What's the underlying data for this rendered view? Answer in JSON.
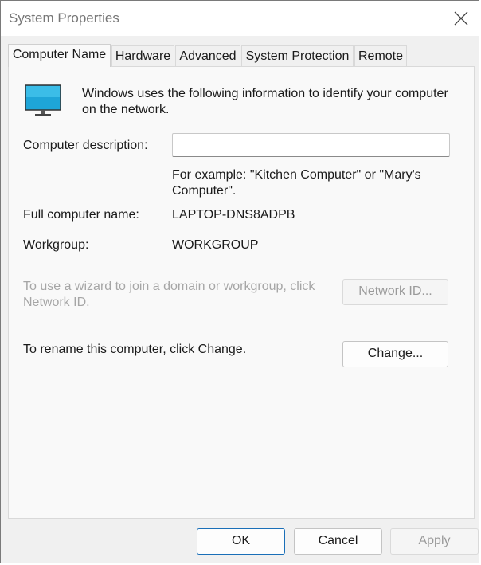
{
  "window": {
    "title": "System Properties"
  },
  "tabs": [
    {
      "label": "Computer Name",
      "active": true
    },
    {
      "label": "Hardware"
    },
    {
      "label": "Advanced"
    },
    {
      "label": "System Protection"
    },
    {
      "label": "Remote"
    }
  ],
  "computer_name": {
    "intro": "Windows uses the following information to identify your computer on the network.",
    "description_label": "Computer description:",
    "description_value": "",
    "example_text": "For example: \"Kitchen Computer\" or \"Mary's Computer\".",
    "full_name_label": "Full computer name:",
    "full_name_value": "LAPTOP-DNS8ADPB",
    "workgroup_label": "Workgroup:",
    "workgroup_value": "WORKGROUP",
    "network_id_text": "To use a wizard to join a domain or workgroup, click Network ID.",
    "network_id_button": "Network ID...",
    "rename_text": "To rename this computer, click Change.",
    "change_button": "Change..."
  },
  "footer": {
    "ok": "OK",
    "cancel": "Cancel",
    "apply": "Apply"
  },
  "icons": {
    "close": "close-icon",
    "monitor": "computer-monitor-icon"
  },
  "colors": {
    "accent": "#1a6fb8",
    "disabled_text": "#a6a6a6",
    "monitor_screen": "#1ea5d8"
  }
}
